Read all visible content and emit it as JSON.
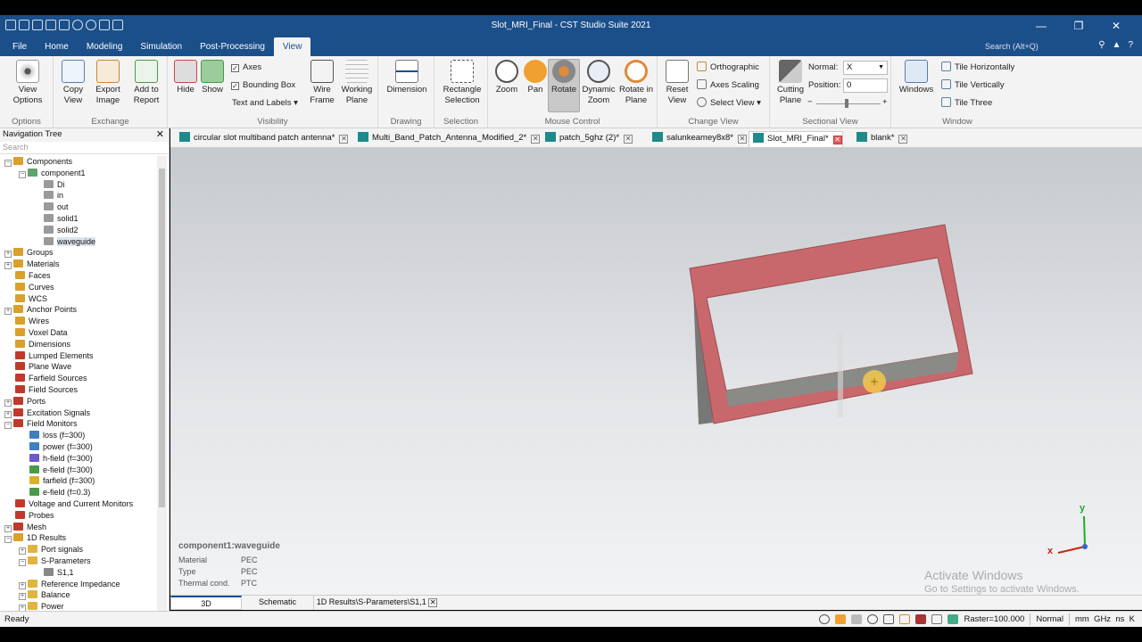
{
  "window": {
    "title": "Slot_MRI_Final - CST Studio Suite 2021"
  },
  "menu": {
    "tabs": [
      "File",
      "Home",
      "Modeling",
      "Simulation",
      "Post-Processing",
      "View"
    ],
    "active_tab": "View",
    "search_placeholder": "Search (Alt+Q)"
  },
  "ribbon": {
    "options": {
      "label": "Options",
      "view_options": "View\nOptions"
    },
    "exchange": {
      "label": "Exchange",
      "copy_view": "Copy\nView",
      "export_image": "Export\nImage",
      "add_to_report": "Add to\nReport"
    },
    "visibility": {
      "label": "Visibility",
      "hide": "Hide",
      "show": "Show",
      "axes": "Axes",
      "bounding_box": "Bounding Box",
      "text_labels": "Text and Labels",
      "wire_frame": "Wire\nFrame",
      "working_plane": "Working\nPlane"
    },
    "drawing": {
      "label": "Drawing",
      "dimension": "Dimension"
    },
    "selection": {
      "label": "Selection",
      "rectangle_selection": "Rectangle\nSelection"
    },
    "mouse_control": {
      "label": "Mouse Control",
      "zoom": "Zoom",
      "pan": "Pan",
      "rotate": "Rotate",
      "dynamic_zoom": "Dynamic\nZoom",
      "rotate_in_plane": "Rotate in\nPlane"
    },
    "change_view": {
      "label": "Change View",
      "reset_view": "Reset\nView",
      "orthographic": "Orthographic",
      "axes_scaling": "Axes Scaling",
      "select_view": "Select View"
    },
    "sectional_view": {
      "label": "Sectional View",
      "cutting_plane": "Cutting\nPlane",
      "normal_label": "Normal:",
      "normal_value": "X",
      "position_label": "Position:",
      "position_value": "0"
    },
    "window": {
      "label": "Window",
      "windows": "Windows",
      "tile_horizontally": "Tile Horizontally",
      "tile_vertically": "Tile Vertically",
      "tile_three": "Tile Three"
    }
  },
  "nav": {
    "title": "Navigation Tree",
    "search_placeholder": "Search",
    "items": [
      {
        "label": "Components",
        "level": 0,
        "pm": "-",
        "color": "#d9a02a"
      },
      {
        "label": "component1",
        "level": 1,
        "pm": "-",
        "color": "#5fa36a"
      },
      {
        "label": "Di",
        "level": 2,
        "pm": "",
        "color": "#9a9a9a"
      },
      {
        "label": "in",
        "level": 2,
        "pm": "",
        "color": "#9a9a9a"
      },
      {
        "label": "out",
        "level": 2,
        "pm": "",
        "color": "#9a9a9a"
      },
      {
        "label": "solid1",
        "level": 2,
        "pm": "",
        "color": "#9a9a9a"
      },
      {
        "label": "solid2",
        "level": 2,
        "pm": "",
        "color": "#9a9a9a"
      },
      {
        "label": "waveguide",
        "level": 2,
        "pm": "",
        "color": "#9a9a9a",
        "selected": true
      },
      {
        "label": "Groups",
        "level": 0,
        "pm": "+",
        "color": "#d9a02a"
      },
      {
        "label": "Materials",
        "level": 0,
        "pm": "+",
        "color": "#d9a02a"
      },
      {
        "label": "Faces",
        "level": 0,
        "pm": "",
        "color": "#d9a02a"
      },
      {
        "label": "Curves",
        "level": 0,
        "pm": "",
        "color": "#d9a02a"
      },
      {
        "label": "WCS",
        "level": 0,
        "pm": "",
        "color": "#d9a02a"
      },
      {
        "label": "Anchor Points",
        "level": 0,
        "pm": "+",
        "color": "#d9a02a"
      },
      {
        "label": "Wires",
        "level": 0,
        "pm": "",
        "color": "#d9a02a"
      },
      {
        "label": "Voxel Data",
        "level": 0,
        "pm": "",
        "color": "#d9a02a"
      },
      {
        "label": "Dimensions",
        "level": 0,
        "pm": "",
        "color": "#d9a02a"
      },
      {
        "label": "Lumped Elements",
        "level": 0,
        "pm": "",
        "color": "#c0392b"
      },
      {
        "label": "Plane Wave",
        "level": 0,
        "pm": "",
        "color": "#c0392b"
      },
      {
        "label": "Farfield Sources",
        "level": 0,
        "pm": "",
        "color": "#c0392b"
      },
      {
        "label": "Field Sources",
        "level": 0,
        "pm": "",
        "color": "#c0392b"
      },
      {
        "label": "Ports",
        "level": 0,
        "pm": "+",
        "color": "#c0392b"
      },
      {
        "label": "Excitation Signals",
        "level": 0,
        "pm": "+",
        "color": "#c0392b"
      },
      {
        "label": "Field Monitors",
        "level": 0,
        "pm": "-",
        "color": "#c0392b"
      },
      {
        "label": "loss (f=300)",
        "level": 1,
        "pm": "",
        "color": "#3f7fbf"
      },
      {
        "label": "power (f=300)",
        "level": 1,
        "pm": "",
        "color": "#3f7fbf"
      },
      {
        "label": "h-field (f=300)",
        "level": 1,
        "pm": "",
        "color": "#6a5acd"
      },
      {
        "label": "e-field (f=300)",
        "level": 1,
        "pm": "",
        "color": "#4a9a4a"
      },
      {
        "label": "farfield (f=300)",
        "level": 1,
        "pm": "",
        "color": "#d9b02a"
      },
      {
        "label": "e-field (f=0.3)",
        "level": 1,
        "pm": "",
        "color": "#4a9a4a"
      },
      {
        "label": "Voltage and Current Monitors",
        "level": 0,
        "pm": "",
        "color": "#c0392b"
      },
      {
        "label": "Probes",
        "level": 0,
        "pm": "",
        "color": "#c0392b"
      },
      {
        "label": "Mesh",
        "level": 0,
        "pm": "+",
        "color": "#c0392b"
      },
      {
        "label": "1D Results",
        "level": 0,
        "pm": "-",
        "color": "#d9a02a"
      },
      {
        "label": "Port signals",
        "level": 1,
        "pm": "+",
        "color": "#e2b341"
      },
      {
        "label": "S-Parameters",
        "level": 1,
        "pm": "-",
        "color": "#e2b341"
      },
      {
        "label": "S1,1",
        "level": 2,
        "pm": "",
        "color": "#888888"
      },
      {
        "label": "Reference Impedance",
        "level": 1,
        "pm": "+",
        "color": "#e2b341"
      },
      {
        "label": "Balance",
        "level": 1,
        "pm": "+",
        "color": "#e2b341"
      },
      {
        "label": "Power",
        "level": 1,
        "pm": "+",
        "color": "#e2b341"
      }
    ]
  },
  "doc_tabs": [
    {
      "label": "circular slot multiband patch antenna*",
      "active": false
    },
    {
      "label": "Multi_Band_Patch_Antenna_Modified_2*",
      "active": false
    },
    {
      "label": "patch_5ghz (2)*",
      "active": false
    },
    {
      "label": "salunkeamey8x8*",
      "active": false
    },
    {
      "label": "Slot_MRI_Final*",
      "active": true
    },
    {
      "label": "blank*",
      "active": false
    }
  ],
  "viewport": {
    "component_title": "component1:waveguide",
    "props": [
      {
        "key": "Material",
        "value": "PEC"
      },
      {
        "key": "Type",
        "value": "PEC"
      },
      {
        "key": "Thermal cond.",
        "value": "PTC"
      }
    ],
    "axis_x": "x",
    "axis_y": "y",
    "watermark_line1": "Activate Windows",
    "watermark_line2": "Go to Settings to activate Windows."
  },
  "bottom_tabs": [
    "3D",
    "Schematic",
    "1D Results\\S-Parameters\\S1,1"
  ],
  "status": {
    "ready": "Ready",
    "raster": "Raster=100.000",
    "mode": "Normal",
    "units": "mm  GHz  ns  K"
  },
  "colors": {
    "accent": "#1b4f8a",
    "frame": "#c8686d",
    "wall": "#8a8a86"
  }
}
